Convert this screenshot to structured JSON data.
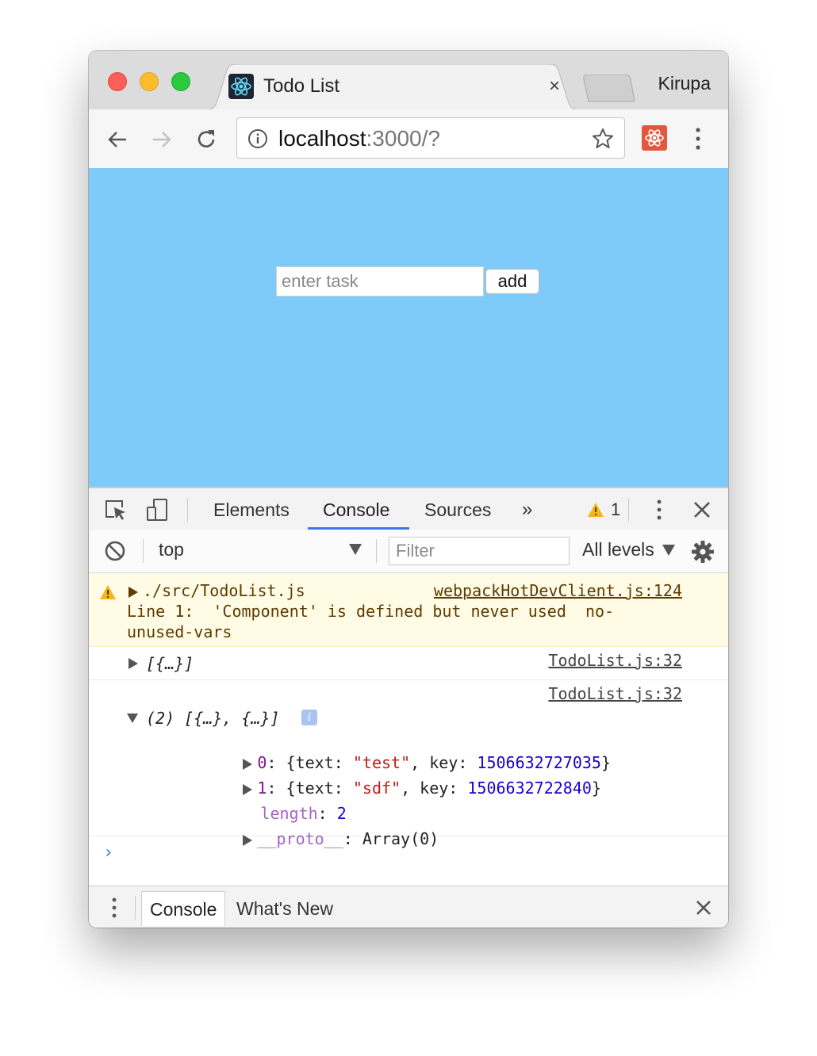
{
  "browser": {
    "tab": {
      "title": "Todo List",
      "close": "×",
      "icon": "react-logo-icon"
    },
    "profile": "Kirupa",
    "omnibox": {
      "host": "localhost",
      "rest": ":3000/?"
    }
  },
  "page": {
    "background": "#7ecbf9",
    "task_input": {
      "placeholder": "enter task",
      "value": ""
    },
    "add_button": "add"
  },
  "devtools": {
    "tabs": [
      "Elements",
      "Console",
      "Sources"
    ],
    "active_tab": "Console",
    "more": "»",
    "warning_count": "1",
    "context": "top",
    "filter_placeholder": "Filter",
    "levels": "All levels",
    "accent": "#3b78e7",
    "messages": {
      "warning": {
        "path": "./src/TodoList.js",
        "source": "webpackHotDevClient.js:124",
        "line1": "Line 1:  'Component' is defined but never used  no-",
        "line2": "unused-vars"
      },
      "log1": {
        "summary": "[{…}]",
        "source": "TodoList.js:32"
      },
      "log2": {
        "source": "TodoList.js:32",
        "summary": "(2) [{…}, {…}]",
        "items": [
          {
            "index": "0",
            "text_key": "text",
            "text_val": "\"test\"",
            "key_key": "key",
            "key_val": "1506632727035"
          },
          {
            "index": "1",
            "text_key": "text",
            "text_val": "\"sdf\"",
            "key_key": "key",
            "key_val": "1506632722840"
          }
        ],
        "length_key": "length",
        "length_val": "2",
        "proto_key": "__proto__",
        "proto_val": "Array(0)"
      }
    },
    "prompt": "›",
    "drawer": {
      "tabs": [
        "Console",
        "What's New"
      ],
      "active": "Console"
    }
  }
}
